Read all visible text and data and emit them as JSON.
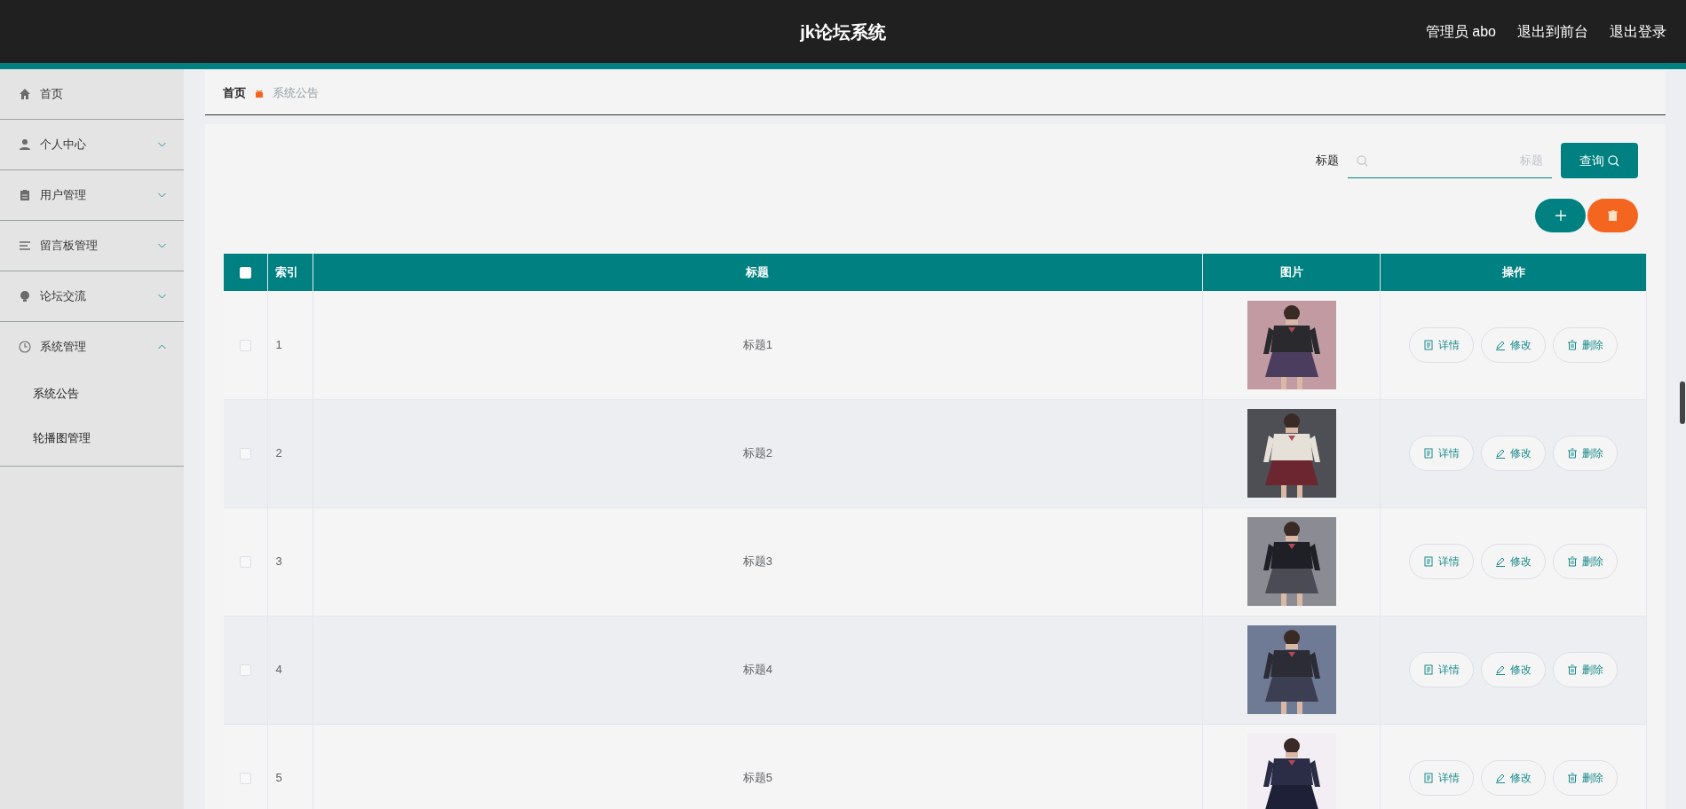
{
  "header": {
    "title": "jk论坛系统",
    "links": [
      "管理员 abo",
      "退出到前台",
      "退出登录"
    ]
  },
  "sidebar": {
    "items": [
      {
        "label": "首页"
      },
      {
        "label": "个人中心",
        "expanded": false
      },
      {
        "label": "用户管理",
        "expanded": false
      },
      {
        "label": "留言板管理",
        "expanded": false
      },
      {
        "label": "论坛交流",
        "expanded": false
      },
      {
        "label": "系统管理",
        "expanded": true,
        "children": [
          {
            "label": "系统公告"
          },
          {
            "label": "轮播图管理"
          }
        ]
      }
    ]
  },
  "breadcrumb": [
    "首页",
    "系统公告"
  ],
  "search": {
    "label": "标题",
    "placeholder": "标题",
    "button": "查询"
  },
  "table": {
    "select_all": {
      "checked": false
    },
    "columns": [
      "索引",
      "标题",
      "图片",
      "操作"
    ],
    "rows": [
      {
        "checked": false,
        "index": "1",
        "title": "标题1",
        "actions": [
          "详情",
          "修改",
          "删除"
        ]
      },
      {
        "checked": false,
        "index": "2",
        "title": "标题2",
        "actions": [
          "详情",
          "修改",
          "删除"
        ]
      },
      {
        "checked": false,
        "index": "3",
        "title": "标题3",
        "actions": [
          "详情",
          "修改",
          "删除"
        ]
      },
      {
        "checked": false,
        "index": "4",
        "title": "标题4",
        "actions": [
          "详情",
          "修改",
          "删除"
        ]
      },
      {
        "checked": false,
        "index": "5",
        "title": "标题5",
        "actions": [
          "详情",
          "修改",
          "删除"
        ]
      }
    ]
  }
}
